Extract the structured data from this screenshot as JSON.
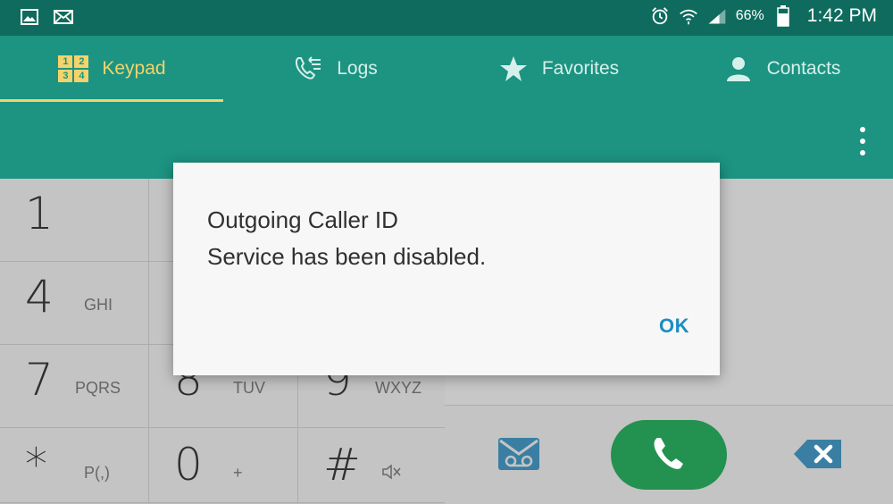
{
  "status_bar": {
    "battery_percent": "66%",
    "time": "1:42 PM",
    "icons": [
      "gallery-icon",
      "mail-icon",
      "alarm-icon",
      "wifi-icon",
      "signal-icon",
      "battery-icon"
    ]
  },
  "tabs": [
    {
      "label": "Keypad",
      "icon": "keypad-icon",
      "active": true
    },
    {
      "label": "Logs",
      "icon": "logs-icon",
      "active": false
    },
    {
      "label": "Favorites",
      "icon": "star-icon",
      "active": false
    },
    {
      "label": "Contacts",
      "icon": "person-icon",
      "active": false
    }
  ],
  "keypad_icon_digits": [
    "1",
    "2",
    "3",
    "4"
  ],
  "keys": [
    {
      "num": "1",
      "sub": ""
    },
    {
      "num": "4",
      "sub": "GHI"
    },
    {
      "num": "7",
      "sub": "PQRS"
    },
    {
      "num": "8",
      "sub": "TUV"
    },
    {
      "num": "9",
      "sub": "WXYZ"
    },
    {
      "num": "*",
      "sub": "P(,)"
    },
    {
      "num": "0",
      "sub": "+"
    },
    {
      "num": "#",
      "sub": ""
    }
  ],
  "dialog": {
    "line1": "Outgoing Caller ID",
    "line2": "Service has been disabled.",
    "ok_label": "OK"
  },
  "colors": {
    "status_bar": "#0e6b5e",
    "app_bar": "#1d9381",
    "active_tab": "#f3d36b",
    "call_button": "#239150",
    "ok_text": "#1b8ec2",
    "action_icon": "#3a7fa3"
  }
}
